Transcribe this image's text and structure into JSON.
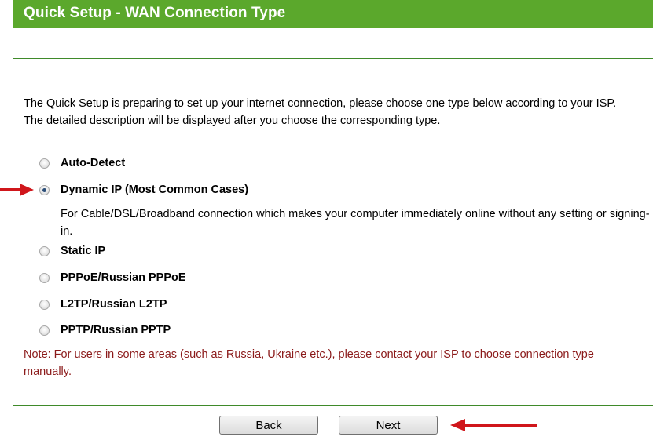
{
  "header": {
    "title": "Quick Setup - WAN Connection Type"
  },
  "description": {
    "line1": "The Quick Setup is preparing to set up your internet connection, please choose one type below according to your ISP.",
    "line2": "The detailed description will be displayed after you choose the corresponding type."
  },
  "options": [
    {
      "label": "Auto-Detect",
      "checked": false
    },
    {
      "label": "Dynamic IP (Most Common Cases)",
      "checked": true
    },
    {
      "label": "Static IP",
      "checked": false
    },
    {
      "label": "PPPoE/Russian PPPoE",
      "checked": false
    },
    {
      "label": "L2TP/Russian L2TP",
      "checked": false
    },
    {
      "label": "PPTP/Russian PPTP",
      "checked": false
    }
  ],
  "selected_help": "For Cable/DSL/Broadband connection which makes your computer immediately online without any setting or signing-in.",
  "note": "Note: For users in some areas (such as Russia, Ukraine etc.), please contact your ISP to choose connection type manually.",
  "buttons": {
    "back": "Back",
    "next": "Next"
  },
  "colors": {
    "title_bar": "#5ba82c",
    "note_text": "#8b1a1a",
    "annotation_arrow": "#d0161b"
  },
  "icons": {
    "annotation_arrow": "red-arrow-icon"
  }
}
